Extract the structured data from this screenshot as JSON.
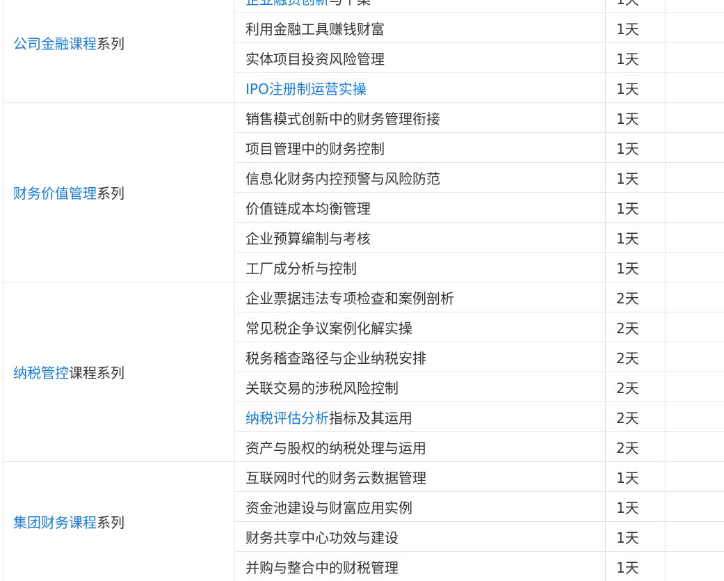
{
  "groups": [
    {
      "series_link": "公司金融课程",
      "series_suffix": "系列",
      "courses": [
        {
          "link": "企业融资创新",
          "text": "与个案",
          "days": "1天"
        },
        {
          "link": "",
          "text": "利用金融工具赚钱财富",
          "days": "1天"
        },
        {
          "link": "",
          "text": "实体项目投资风险管理",
          "days": "1天"
        },
        {
          "link": "IPO注册制运营实操",
          "text": "",
          "days": "1天"
        }
      ]
    },
    {
      "series_link": "财务价值管理",
      "series_suffix": "系列",
      "courses": [
        {
          "link": "",
          "text": "销售模式创新中的财务管理衔接",
          "days": "1天"
        },
        {
          "link": "",
          "text": "项目管理中的财务控制",
          "days": "1天"
        },
        {
          "link": "",
          "text": "信息化财务内控预警与风险防范",
          "days": "1天"
        },
        {
          "link": "",
          "text": "价值链成本均衡管理",
          "days": "1天"
        },
        {
          "link": "",
          "text": "企业预算编制与考核",
          "days": "1天"
        },
        {
          "link": "",
          "text": "工厂成分析与控制",
          "days": "1天"
        }
      ]
    },
    {
      "series_link": "纳税管控",
      "series_suffix": "课程系列",
      "courses": [
        {
          "link": "",
          "text": "企业票据违法专项检查和案例剖析",
          "days": "2天"
        },
        {
          "link": "",
          "text": "常见税企争议案例化解实操",
          "days": "2天"
        },
        {
          "link": "",
          "text": "税务稽查路径与企业纳税安排",
          "days": "2天"
        },
        {
          "link": "",
          "text": "关联交易的涉税风险控制",
          "days": "2天"
        },
        {
          "link": "纳税评估分析",
          "text": "指标及其运用",
          "days": "2天"
        },
        {
          "link": "",
          "text": "资产与股权的纳税处理与运用",
          "days": "2天"
        }
      ]
    },
    {
      "series_link": "集团财务课程",
      "series_suffix": "系列",
      "courses": [
        {
          "link": "",
          "text": "互联网时代的财务云数据管理",
          "days": "1天"
        },
        {
          "link": "",
          "text": "资金池建设与财富应用实例",
          "days": "1天"
        },
        {
          "link": "",
          "text": "财务共享中心功效与建设",
          "days": "1天"
        },
        {
          "link": "",
          "text": "并购与整合中的财税管理",
          "days": "1天"
        }
      ]
    }
  ]
}
